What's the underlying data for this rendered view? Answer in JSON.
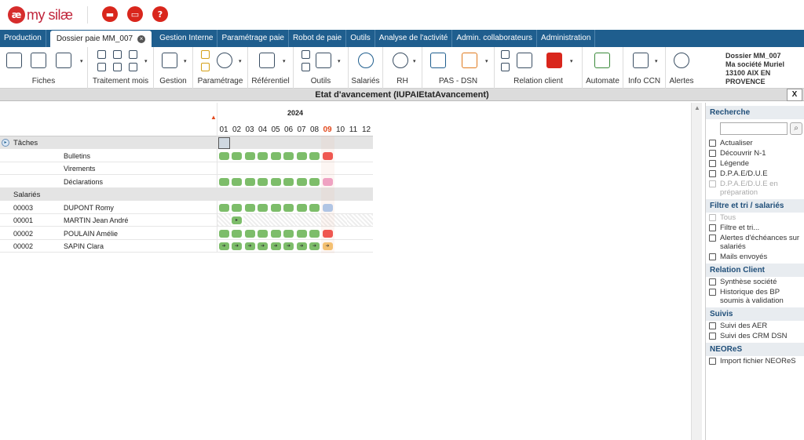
{
  "app": {
    "logo_mark": "æ",
    "logo_text": "my silæ"
  },
  "top_buttons": [
    {
      "name": "folder-icon",
      "glyph": "▬"
    },
    {
      "name": "inbox-icon",
      "glyph": "▭"
    },
    {
      "name": "help-icon",
      "glyph": "?"
    }
  ],
  "tabs": [
    {
      "label": "Production",
      "active": false
    },
    {
      "label": "Dossier paie MM_007",
      "active": true
    },
    {
      "label": "Gestion Interne",
      "active": false
    },
    {
      "label": "Paramétrage paie",
      "active": false
    },
    {
      "label": "Robot de paie",
      "active": false
    },
    {
      "label": "Outils",
      "active": false
    },
    {
      "label": "Analyse de l'activité",
      "active": false
    },
    {
      "label": "Admin. collaborateurs",
      "active": false
    },
    {
      "label": "Administration",
      "active": false
    }
  ],
  "ribbon_groups": [
    "Fiches",
    "Traitement mois",
    "Gestion",
    "Paramétrage",
    "Référentiel",
    "Outils",
    "Salariés",
    "RH",
    "PAS - DSN",
    "Relation client",
    "Automate",
    "Info CCN",
    "Alertes"
  ],
  "company": {
    "line1": "Dossier MM_007",
    "line2": "Ma société Muriel",
    "line3": "13100 AIX EN PROVENCE"
  },
  "window": {
    "title": "Etat d'avancement (IUPAIEtatAvancement)",
    "close": "X"
  },
  "grid": {
    "year": "2024",
    "months": [
      "01",
      "02",
      "03",
      "04",
      "05",
      "06",
      "07",
      "08",
      "09",
      "10",
      "11",
      "12"
    ],
    "current_month": "09",
    "sections": [
      {
        "label": "Tâches",
        "rows": [
          {
            "code": "",
            "name": "Bulletins",
            "status": [
              "green",
              "green",
              "green",
              "green",
              "green",
              "green",
              "green",
              "green",
              "red",
              "",
              "",
              ""
            ]
          },
          {
            "code": "",
            "name": "Virements",
            "status": [
              "",
              "",
              "",
              "",
              "",
              "",
              "",
              "",
              "",
              "",
              "",
              ""
            ]
          },
          {
            "code": "",
            "name": "Déclarations",
            "status": [
              "green",
              "green",
              "green",
              "green",
              "green",
              "green",
              "green",
              "green",
              "pink",
              "",
              "",
              ""
            ]
          }
        ]
      },
      {
        "label": "Salariés",
        "rows": [
          {
            "code": "00003",
            "name": "DUPONT Romy",
            "status": [
              "green",
              "green",
              "green",
              "green",
              "green",
              "green",
              "green",
              "green",
              "blue",
              "",
              "",
              ""
            ]
          },
          {
            "code": "00001",
            "name": "MARTIN Jean André",
            "status": [
              "hatch",
              "green-flag",
              "hatch",
              "hatch",
              "hatch",
              "hatch",
              "hatch",
              "hatch",
              "hatch",
              "hatch",
              "hatch",
              "hatch"
            ]
          },
          {
            "code": "00002",
            "name": "POULAIN Amélie",
            "status": [
              "green",
              "green",
              "green",
              "green",
              "green",
              "green",
              "green",
              "green",
              "red",
              "",
              "",
              ""
            ]
          },
          {
            "code": "00002",
            "name": "SAPIN Clara",
            "status": [
              "green-arrow",
              "green-arrow",
              "green-arrow",
              "green-arrow",
              "green-arrow",
              "green-arrow",
              "green-arrow",
              "green-arrow",
              "orange-arrow",
              "",
              "",
              ""
            ]
          }
        ]
      }
    ]
  },
  "colors": {
    "green": "#7dbd6a",
    "red": "#f04a46",
    "pink": "#f0a0c8",
    "blue": "#a9c8ee",
    "orange": "#f5c26b",
    "nav": "#1f5e8e"
  },
  "sidebar": {
    "sections": [
      {
        "title": "Recherche",
        "search_placeholder": "",
        "items": [
          {
            "label": "Actualiser",
            "icon": "refresh-icon",
            "disabled": false
          },
          {
            "label": "Découvrir N-1",
            "icon": "double-chevron-left-icon",
            "disabled": false
          },
          {
            "label": "Légende",
            "icon": "list-icon",
            "disabled": false
          },
          {
            "label": "D.P.A.E/D.U.E",
            "icon": "add-circle-icon",
            "disabled": false
          },
          {
            "label": "D.P.A.E/D.U.E en préparation",
            "icon": "close-box-icon",
            "disabled": true
          }
        ]
      },
      {
        "title": "Filtre et tri / salariés",
        "items": [
          {
            "label": "Tous",
            "icon": "play-icon",
            "disabled": true
          },
          {
            "label": "Filtre et tri...",
            "icon": "filter-icon",
            "disabled": false
          },
          {
            "label": "Alertes d'échéances sur salariés",
            "icon": "clock-icon",
            "disabled": false
          },
          {
            "label": "Mails envoyés",
            "icon": "mail-icon",
            "disabled": false
          }
        ]
      },
      {
        "title": "Relation Client",
        "items": [
          {
            "label": "Synthèse société",
            "icon": "doc-icon",
            "disabled": false
          },
          {
            "label": "Historique des BP soumis à validation",
            "icon": "history-icon",
            "disabled": false
          }
        ]
      },
      {
        "title": "Suivis",
        "items": [
          {
            "label": "Suivi des AER",
            "icon": "doc-icon",
            "disabled": false
          },
          {
            "label": "Suivi des CRM DSN",
            "icon": "doc-icon",
            "disabled": false
          }
        ]
      },
      {
        "title": "NEOReS",
        "items": [
          {
            "label": "Import fichier NEOReS",
            "icon": "import-icon",
            "disabled": false
          }
        ]
      }
    ]
  }
}
